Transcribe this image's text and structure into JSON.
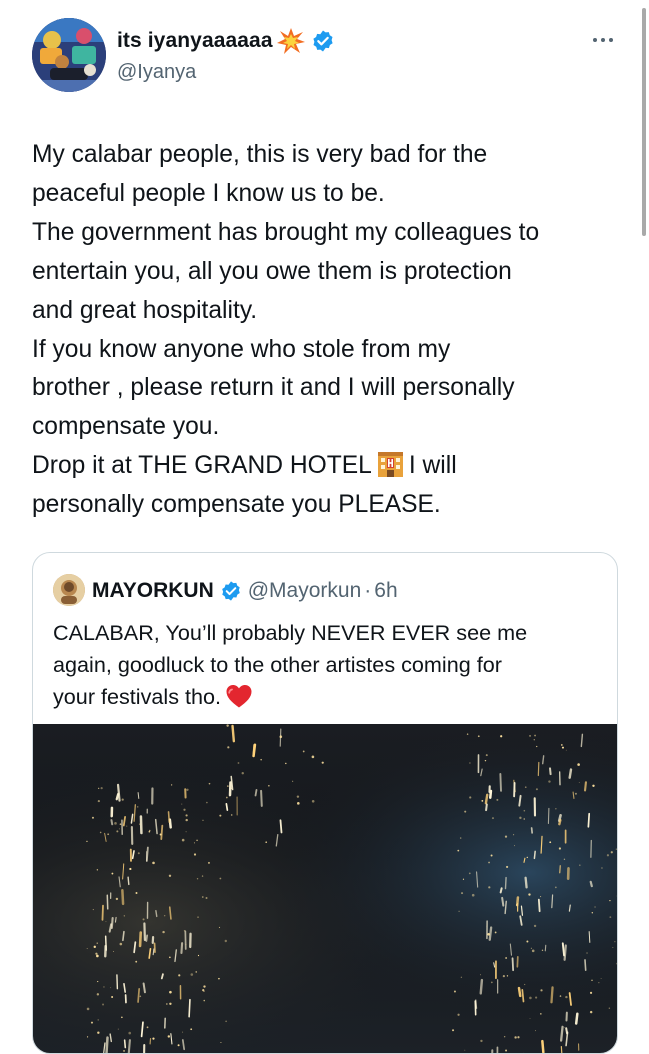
{
  "tweet": {
    "display_name": "its iyanyaaaaaa",
    "name_emoji": "collision-icon",
    "handle": "@Iyanya",
    "verified": true,
    "text_lines": [
      "My calabar people, this is very bad for the",
      "peaceful people I know us to be.",
      "The government has brought my colleagues to",
      "entertain you, all you owe them is protection",
      "and great hospitality.",
      "If you know anyone who stole from my",
      "brother  , please return it and I will personally",
      "compensate you."
    ],
    "text_line_9_before": "Drop it at THE GRAND HOTEL",
    "text_line_9_icon": "hotel-icon",
    "text_line_9_after": "I will",
    "text_line_10": "personally compensate you PLEASE."
  },
  "quoted": {
    "display_name": "MAYORKUN",
    "verified": true,
    "handle": "@Mayorkun",
    "separator": "·",
    "time": "6h",
    "text_lines": [
      "CALABAR, You’ll probably NEVER EVER  see me",
      "again, goodluck to the other artistes coming for"
    ],
    "text_last_line": "your festivals tho.",
    "text_icon": "red-heart-icon",
    "media": "fireworks-video-thumbnail"
  },
  "colors": {
    "verified_blue": "#1d9bf0",
    "text_primary": "#0f1419",
    "text_secondary": "#536471",
    "border": "#cfd9de"
  }
}
